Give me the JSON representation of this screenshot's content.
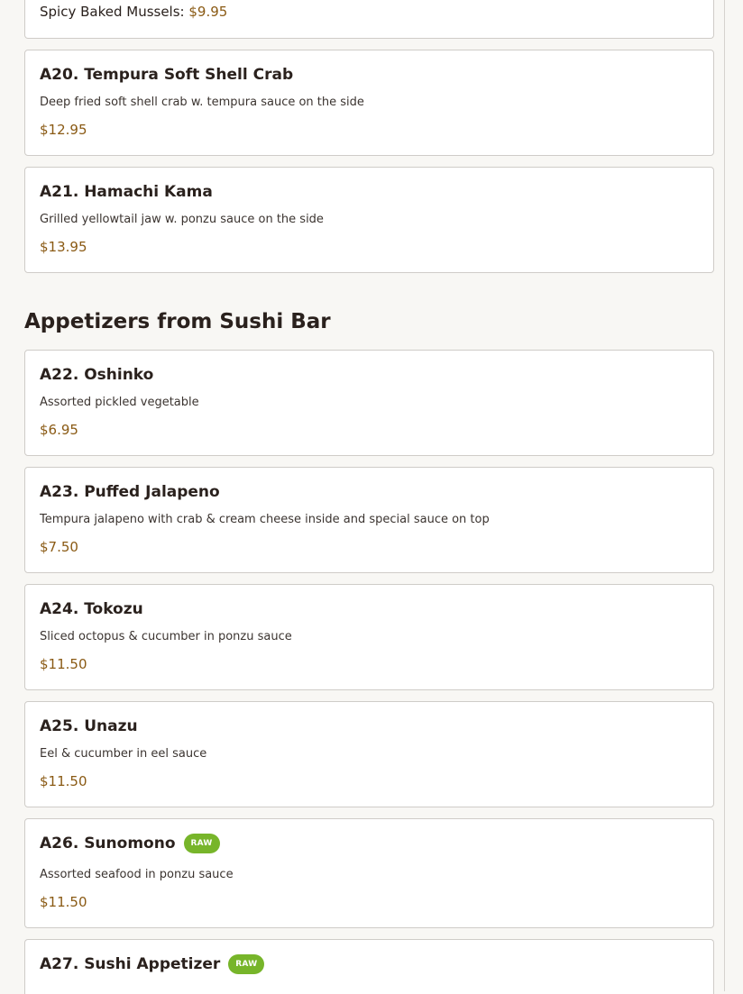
{
  "colors": {
    "page_bg": "#f8f7f4",
    "card_bg": "#ffffff",
    "card_border": "#cfccc8",
    "title": "#2a211d",
    "price": "#8a5a14",
    "badge_bg": "#77b52a",
    "badge_text": "#ffffff"
  },
  "top_partial": {
    "name": "Spicy Baked Mussels:",
    "price": "$9.95"
  },
  "items_group1": [
    {
      "title": "A20. Tempura Soft Shell Crab",
      "desc": "Deep fried soft shell crab w. tempura sauce on the side",
      "price": "$12.95"
    },
    {
      "title": "A21. Hamachi Kama",
      "desc": "Grilled yellowtail jaw w. ponzu sauce on the side",
      "price": "$13.95"
    }
  ],
  "section": {
    "title": "Appetizers from Sushi Bar"
  },
  "items_group2": [
    {
      "title": "A22. Oshinko",
      "desc": "Assorted pickled vegetable",
      "price": "$6.95"
    },
    {
      "title": "A23. Puffed Jalapeno",
      "desc": "Tempura jalapeno with crab & cream cheese inside and special sauce on top",
      "price": "$7.50"
    },
    {
      "title": "A24. Tokozu",
      "desc": "Sliced octopus & cucumber in ponzu sauce",
      "price": "$11.50"
    },
    {
      "title": "A25. Unazu",
      "desc": "Eel & cucumber in eel sauce",
      "price": "$11.50"
    },
    {
      "title": "A26. Sunomono",
      "badge": "RAW",
      "desc": "Assorted seafood in ponzu sauce",
      "price": "$11.50"
    }
  ],
  "bottom_partial": {
    "title": "A27. Sushi Appetizer",
    "badge": "RAW"
  }
}
